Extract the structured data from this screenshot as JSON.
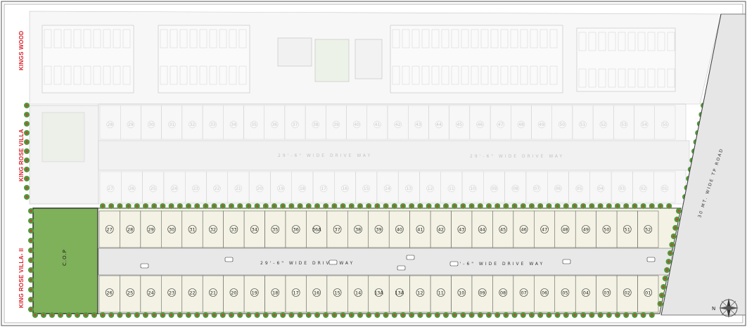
{
  "labels": {
    "kings_wood": "KINGS WOOD",
    "king_rose_villa": "KING ROSE VILLA",
    "king_rose_villa_ii": "KING ROSE VILLA- II",
    "tp_road": "30 MT. WIDE TP ROAD",
    "drive_way": "29'-6\" WIDE DRIVE WAY",
    "cop": "C.O.P",
    "north": "N"
  },
  "plots": {
    "upper_row": [
      "27",
      "28",
      "29",
      "30",
      "31",
      "32",
      "33",
      "34",
      "35",
      "36",
      "36A",
      "37",
      "38",
      "39",
      "40",
      "41",
      "42",
      "43",
      "44",
      "45",
      "46",
      "47",
      "48",
      "49",
      "50",
      "51",
      "52"
    ],
    "lower_row": [
      "26",
      "25",
      "24",
      "23",
      "22",
      "21",
      "20",
      "19",
      "18",
      "17",
      "16",
      "15",
      "14",
      "13A",
      "13A",
      "12",
      "11",
      "10",
      "09",
      "08",
      "07",
      "06",
      "05",
      "04",
      "03",
      "02",
      "01"
    ]
  },
  "faded": {
    "upper_row": [
      "28",
      "29",
      "30",
      "31",
      "32",
      "33",
      "34",
      "35",
      "36",
      "37",
      "38",
      "39",
      "40",
      "41",
      "42",
      "43",
      "44",
      "45",
      "46",
      "47",
      "48",
      "49",
      "50",
      "51",
      "52",
      "53",
      "54",
      "55"
    ],
    "lower_row": [
      "27",
      "26",
      "25",
      "24",
      "23",
      "22",
      "21",
      "20",
      "19",
      "18",
      "17",
      "16",
      "15",
      "14",
      "13",
      "12",
      "11",
      "10",
      "09",
      "08",
      "07",
      "06",
      "05",
      "04",
      "03",
      "02",
      "01"
    ]
  },
  "colors": {
    "cop_green": "#7fb05a",
    "plot_fill": "#f3f2e4",
    "road_fill": "#e8e8e8",
    "tree_green": "#4f9a3a",
    "tree_red": "#c9413a",
    "label_red": "#d61f26"
  }
}
